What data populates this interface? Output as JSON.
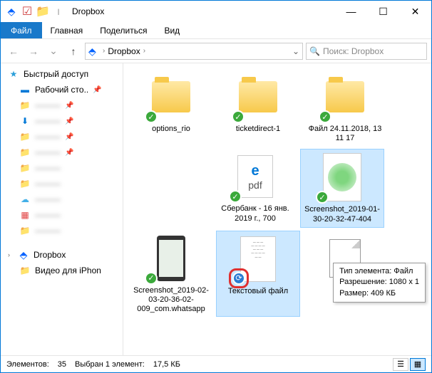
{
  "titlebar": {
    "title": "Dropbox"
  },
  "window_controls": {
    "min": "—",
    "max": "☐",
    "close": "✕"
  },
  "menubar": {
    "file": "Файл",
    "home": "Главная",
    "share": "Поделиться",
    "view": "Вид"
  },
  "breadcrumb": {
    "segment": "Dropbox",
    "sep": "›"
  },
  "search": {
    "placeholder": "Поиск: Dropbox"
  },
  "sidebar": {
    "quick_access": "Быстрый доступ",
    "desktop": "Рабочий сто..",
    "dropbox": "Dropbox",
    "video": "Видео для iPhon",
    "blurred": [
      "———",
      "———",
      "———",
      "———",
      "———",
      "———",
      "———",
      "———"
    ]
  },
  "items": [
    {
      "name": "options_rio",
      "type": "folder",
      "sync": "ok"
    },
    {
      "name": "ticketdirect-1",
      "type": "folder",
      "sync": "ok"
    },
    {
      "name": "Файл 24.11.2018, 13 11 17",
      "type": "folder",
      "sync": "ok"
    },
    {
      "name": "Сбербанк - 16 янв. 2019 г., 700",
      "type": "pdf",
      "sync": "ok"
    },
    {
      "name": "Screenshot_2019-01-30-20-32-47-404",
      "type": "screenshot",
      "sync": "ok",
      "selected": true
    },
    {
      "name": "Screenshot_2019-02-03-20-36-02-009_com.whatsapp",
      "type": "phone",
      "sync": "ok"
    },
    {
      "name": "Текстовый файл",
      "type": "doc",
      "sync": "syncing",
      "selected": true
    },
    {
      "name": "",
      "type": "txt",
      "sync": "none"
    }
  ],
  "tooltip": {
    "line1": "Тип элемента: Файл",
    "line2": "Разрешение: 1080 x 1",
    "line3": "Размер: 409 КБ"
  },
  "statusbar": {
    "count_label": "Элементов:",
    "count": "35",
    "selected_label": "Выбран 1 элемент:",
    "selected_size": "17,5 КБ"
  }
}
